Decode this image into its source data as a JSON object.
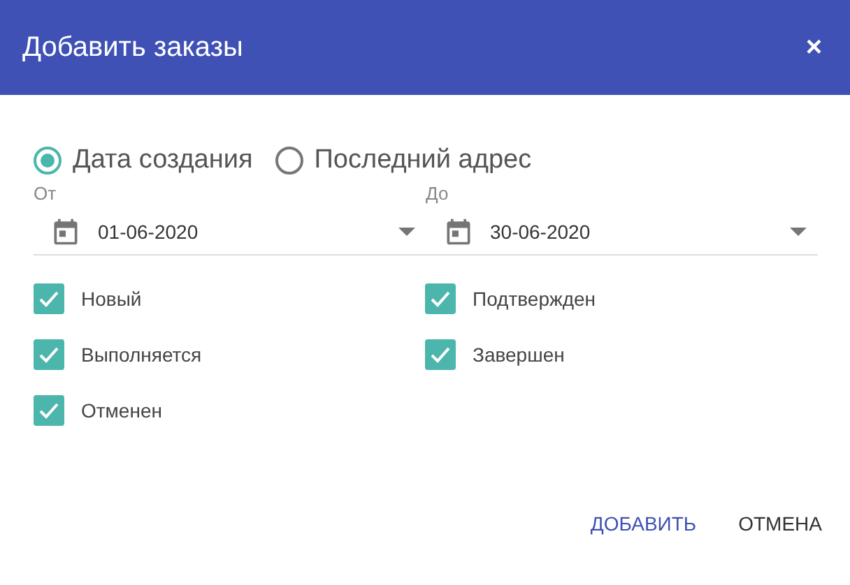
{
  "dialog": {
    "title": "Добавить заказы",
    "close": "×"
  },
  "date_mode": [
    {
      "label": "Дата создания",
      "selected": true
    },
    {
      "label": "Последний адрес",
      "selected": false
    }
  ],
  "range": [
    {
      "label": "От",
      "value": "01-06-2020"
    },
    {
      "label": "До",
      "value": "30-06-2020"
    }
  ],
  "statuses": [
    {
      "label": "Новый",
      "checked": true
    },
    {
      "label": "Подтвержден",
      "checked": true
    },
    {
      "label": "Выполняется",
      "checked": true
    },
    {
      "label": "Завершен",
      "checked": true
    },
    {
      "label": "Отменен",
      "checked": true
    }
  ],
  "buttons": [
    {
      "label": "ДОБАВИТЬ",
      "kind": "primary"
    },
    {
      "label": "ОТМЕНА",
      "kind": "secondary"
    }
  ]
}
